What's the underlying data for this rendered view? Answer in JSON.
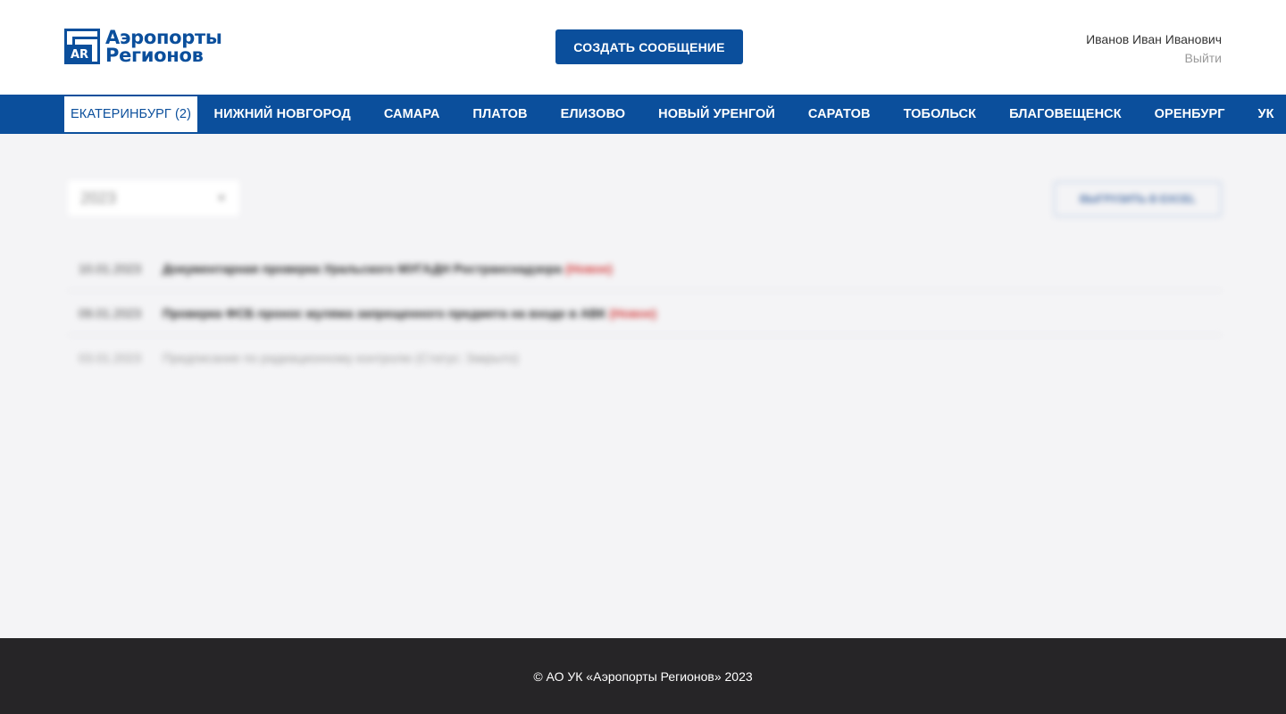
{
  "header": {
    "logo_line1": "Аэропорты",
    "logo_line2": "Регионов",
    "logo_mark": "AR",
    "create_button": "СОЗДАТЬ СООБЩЕНИЕ",
    "user_name": "Иванов Иван Иванович",
    "logout": "Выйти"
  },
  "nav": {
    "items": [
      {
        "label": "ЕКАТЕРИНБУРГ (2)",
        "active": true
      },
      {
        "label": "НИЖНИЙ НОВГОРОД"
      },
      {
        "label": "САМАРА"
      },
      {
        "label": "ПЛАТОВ"
      },
      {
        "label": "ЕЛИЗОВО"
      },
      {
        "label": "НОВЫЙ УРЕНГОЙ"
      },
      {
        "label": "САРАТОВ"
      },
      {
        "label": "ТОБОЛЬСК"
      },
      {
        "label": "БЛАГОВЕЩЕНСК"
      },
      {
        "label": "ОРЕНБУРГ"
      },
      {
        "label": "УК"
      }
    ]
  },
  "main": {
    "year_value": "2023",
    "excel_button": "ВЫГРУЗИТЬ В EXCEL",
    "messages": [
      {
        "date": "10.01.2023",
        "title": "Документарная проверка Уральского МУГАДН Ространснадзора",
        "status": "(Новое)"
      },
      {
        "date": "09.01.2023",
        "title": "Проверка ФСБ пронос муляжа запрещенного предмета на входе в АВК",
        "status": "(Новое)"
      },
      {
        "date": "03.01.2023",
        "title": "Предписание по радиационному контролю (Статус: Закрыто)",
        "status": ""
      }
    ]
  },
  "footer": {
    "copyright": "© АО УК «Аэропорты Регионов» 2023"
  },
  "colors": {
    "brand": "#0b4f9c",
    "background": "#f4f4f6",
    "footer": "#262527",
    "status_new": "#d23a3a"
  }
}
